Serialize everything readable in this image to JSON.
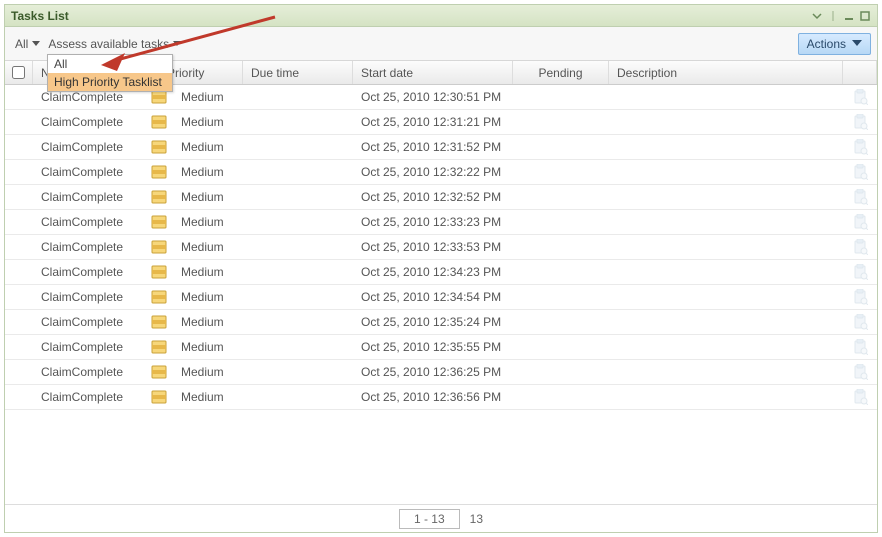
{
  "panel": {
    "title": "Tasks List"
  },
  "toolbar": {
    "filter1_label": "All",
    "filter2_label": "Assess available tasks",
    "actions_label": "Actions"
  },
  "dropdown": {
    "items": [
      {
        "label": "All",
        "highlighted": false
      },
      {
        "label": "High Priority Tasklist",
        "highlighted": true
      }
    ]
  },
  "headers": {
    "name": "Name",
    "priority": "Priority",
    "due": "Due time",
    "start": "Start date",
    "pending": "Pending",
    "description": "Description"
  },
  "rows": [
    {
      "name": "ClaimComplete",
      "priority": "Medium",
      "due": "",
      "start": "Oct 25, 2010 12:30:51 PM",
      "pending": "",
      "description": ""
    },
    {
      "name": "ClaimComplete",
      "priority": "Medium",
      "due": "",
      "start": "Oct 25, 2010 12:31:21 PM",
      "pending": "",
      "description": ""
    },
    {
      "name": "ClaimComplete",
      "priority": "Medium",
      "due": "",
      "start": "Oct 25, 2010 12:31:52 PM",
      "pending": "",
      "description": ""
    },
    {
      "name": "ClaimComplete",
      "priority": "Medium",
      "due": "",
      "start": "Oct 25, 2010 12:32:22 PM",
      "pending": "",
      "description": ""
    },
    {
      "name": "ClaimComplete",
      "priority": "Medium",
      "due": "",
      "start": "Oct 25, 2010 12:32:52 PM",
      "pending": "",
      "description": ""
    },
    {
      "name": "ClaimComplete",
      "priority": "Medium",
      "due": "",
      "start": "Oct 25, 2010 12:33:23 PM",
      "pending": "",
      "description": ""
    },
    {
      "name": "ClaimComplete",
      "priority": "Medium",
      "due": "",
      "start": "Oct 25, 2010 12:33:53 PM",
      "pending": "",
      "description": ""
    },
    {
      "name": "ClaimComplete",
      "priority": "Medium",
      "due": "",
      "start": "Oct 25, 2010 12:34:23 PM",
      "pending": "",
      "description": ""
    },
    {
      "name": "ClaimComplete",
      "priority": "Medium",
      "due": "",
      "start": "Oct 25, 2010 12:34:54 PM",
      "pending": "",
      "description": ""
    },
    {
      "name": "ClaimComplete",
      "priority": "Medium",
      "due": "",
      "start": "Oct 25, 2010 12:35:24 PM",
      "pending": "",
      "description": ""
    },
    {
      "name": "ClaimComplete",
      "priority": "Medium",
      "due": "",
      "start": "Oct 25, 2010 12:35:55 PM",
      "pending": "",
      "description": ""
    },
    {
      "name": "ClaimComplete",
      "priority": "Medium",
      "due": "",
      "start": "Oct 25, 2010 12:36:25 PM",
      "pending": "",
      "description": ""
    },
    {
      "name": "ClaimComplete",
      "priority": "Medium",
      "due": "",
      "start": "Oct 25, 2010 12:36:56 PM",
      "pending": "",
      "description": ""
    }
  ],
  "footer": {
    "range": "1 - 13",
    "total": "13"
  }
}
